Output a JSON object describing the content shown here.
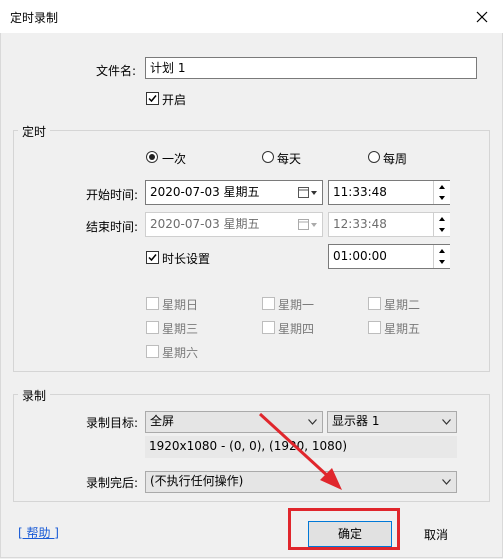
{
  "window": {
    "title": "定时录制"
  },
  "file": {
    "label": "文件名:",
    "value": "计划 1",
    "enable_label": "开启"
  },
  "schedule": {
    "legend": "定时",
    "radios": [
      "一次",
      "每天",
      "每周"
    ],
    "start_label": "开始时间:",
    "start_date": "2020-07-03 星期五",
    "start_time": "11:33:48",
    "end_label": "结束时间:",
    "end_date": "2020-07-03 星期五",
    "end_time": "12:33:48",
    "duration_label": "时长设置",
    "duration_value": "01:00:00",
    "weekdays": [
      "星期日",
      "星期一",
      "星期二",
      "星期三",
      "星期四",
      "星期五",
      "星期六"
    ]
  },
  "record": {
    "legend": "录制",
    "target_label": "录制目标:",
    "target_value": "全屏",
    "display_value": "显示器 1",
    "resolution_info": "1920x1080 - (0, 0), (1920, 1080)",
    "after_label": "录制完后:",
    "after_value": "(不执行任何操作)"
  },
  "footer": {
    "help": "[ 帮助 ]",
    "ok": "确定",
    "cancel": "取消"
  },
  "colors": {
    "highlight": "#e0262c",
    "arrow": "#e0262c",
    "link": "#1a5bd6"
  }
}
